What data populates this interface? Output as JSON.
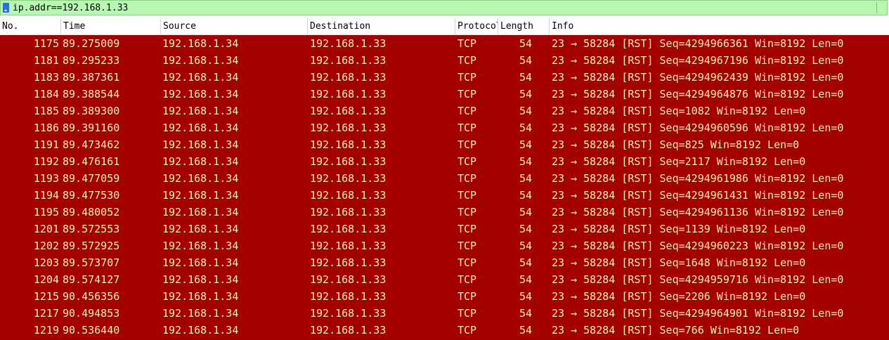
{
  "filter": {
    "value": "ip.addr==192.168.1.33",
    "icon": "bookmark-icon"
  },
  "columns": {
    "no": "No.",
    "time": "Time",
    "source": "Source",
    "destination": "Destination",
    "protocol": "Protocol",
    "length": "Length",
    "info": "Info"
  },
  "colors": {
    "row_background": "#a40000",
    "row_text": "#fff3a8",
    "filter_background": "#b7f8b0"
  },
  "packets": [
    {
      "no": "1175",
      "time": "89.275009",
      "source": "192.168.1.34",
      "destination": "192.168.1.33",
      "protocol": "TCP",
      "length": "54",
      "info": "23 → 58284 [RST] Seq=4294966361 Win=8192 Len=0"
    },
    {
      "no": "1181",
      "time": "89.295233",
      "source": "192.168.1.34",
      "destination": "192.168.1.33",
      "protocol": "TCP",
      "length": "54",
      "info": "23 → 58284 [RST] Seq=4294967196 Win=8192 Len=0"
    },
    {
      "no": "1183",
      "time": "89.387361",
      "source": "192.168.1.34",
      "destination": "192.168.1.33",
      "protocol": "TCP",
      "length": "54",
      "info": "23 → 58284 [RST] Seq=4294962439 Win=8192 Len=0"
    },
    {
      "no": "1184",
      "time": "89.388544",
      "source": "192.168.1.34",
      "destination": "192.168.1.33",
      "protocol": "TCP",
      "length": "54",
      "info": "23 → 58284 [RST] Seq=4294964876 Win=8192 Len=0"
    },
    {
      "no": "1185",
      "time": "89.389300",
      "source": "192.168.1.34",
      "destination": "192.168.1.33",
      "protocol": "TCP",
      "length": "54",
      "info": "23 → 58284 [RST] Seq=1082 Win=8192 Len=0"
    },
    {
      "no": "1186",
      "time": "89.391160",
      "source": "192.168.1.34",
      "destination": "192.168.1.33",
      "protocol": "TCP",
      "length": "54",
      "info": "23 → 58284 [RST] Seq=4294960596 Win=8192 Len=0"
    },
    {
      "no": "1191",
      "time": "89.473462",
      "source": "192.168.1.34",
      "destination": "192.168.1.33",
      "protocol": "TCP",
      "length": "54",
      "info": "23 → 58284 [RST] Seq=825 Win=8192 Len=0"
    },
    {
      "no": "1192",
      "time": "89.476161",
      "source": "192.168.1.34",
      "destination": "192.168.1.33",
      "protocol": "TCP",
      "length": "54",
      "info": "23 → 58284 [RST] Seq=2117 Win=8192 Len=0"
    },
    {
      "no": "1193",
      "time": "89.477059",
      "source": "192.168.1.34",
      "destination": "192.168.1.33",
      "protocol": "TCP",
      "length": "54",
      "info": "23 → 58284 [RST] Seq=4294961986 Win=8192 Len=0"
    },
    {
      "no": "1194",
      "time": "89.477530",
      "source": "192.168.1.34",
      "destination": "192.168.1.33",
      "protocol": "TCP",
      "length": "54",
      "info": "23 → 58284 [RST] Seq=4294961431 Win=8192 Len=0"
    },
    {
      "no": "1195",
      "time": "89.480052",
      "source": "192.168.1.34",
      "destination": "192.168.1.33",
      "protocol": "TCP",
      "length": "54",
      "info": "23 → 58284 [RST] Seq=4294961136 Win=8192 Len=0"
    },
    {
      "no": "1201",
      "time": "89.572553",
      "source": "192.168.1.34",
      "destination": "192.168.1.33",
      "protocol": "TCP",
      "length": "54",
      "info": "23 → 58284 [RST] Seq=1139 Win=8192 Len=0"
    },
    {
      "no": "1202",
      "time": "89.572925",
      "source": "192.168.1.34",
      "destination": "192.168.1.33",
      "protocol": "TCP",
      "length": "54",
      "info": "23 → 58284 [RST] Seq=4294960223 Win=8192 Len=0"
    },
    {
      "no": "1203",
      "time": "89.573707",
      "source": "192.168.1.34",
      "destination": "192.168.1.33",
      "protocol": "TCP",
      "length": "54",
      "info": "23 → 58284 [RST] Seq=1648 Win=8192 Len=0"
    },
    {
      "no": "1204",
      "time": "89.574127",
      "source": "192.168.1.34",
      "destination": "192.168.1.33",
      "protocol": "TCP",
      "length": "54",
      "info": "23 → 58284 [RST] Seq=4294959716 Win=8192 Len=0"
    },
    {
      "no": "1215",
      "time": "90.456356",
      "source": "192.168.1.34",
      "destination": "192.168.1.33",
      "protocol": "TCP",
      "length": "54",
      "info": "23 → 58284 [RST] Seq=2206 Win=8192 Len=0"
    },
    {
      "no": "1217",
      "time": "90.494853",
      "source": "192.168.1.34",
      "destination": "192.168.1.33",
      "protocol": "TCP",
      "length": "54",
      "info": "23 → 58284 [RST] Seq=4294964901 Win=8192 Len=0"
    },
    {
      "no": "1219",
      "time": "90.536440",
      "source": "192.168.1.34",
      "destination": "192.168.1.33",
      "protocol": "TCP",
      "length": "54",
      "info": "23 → 58284 [RST] Seq=766 Win=8192 Len=0"
    }
  ]
}
